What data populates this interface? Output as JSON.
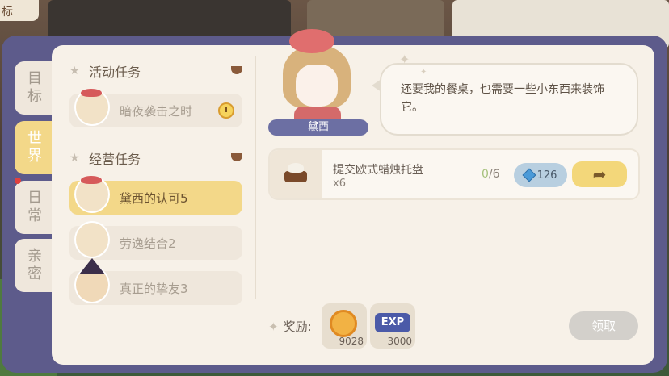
{
  "background": {
    "sign_text": "标"
  },
  "tabs": [
    {
      "label": "目标",
      "active": false,
      "has_dot": false
    },
    {
      "label": "世界",
      "active": true,
      "has_dot": false
    },
    {
      "label": "日常",
      "active": false,
      "has_dot": true
    },
    {
      "label": "亲密",
      "active": false,
      "has_dot": false
    }
  ],
  "sections": {
    "activity": {
      "title": "活动任务",
      "tasks": [
        {
          "label": "暗夜袭击之时",
          "icon": "clock-icon"
        }
      ]
    },
    "business": {
      "title": "经营任务",
      "tasks": [
        {
          "label": "黛西的认可5",
          "active": true
        },
        {
          "label": "劳逸结合2",
          "active": false
        },
        {
          "label": "真正的挚友3",
          "active": false
        }
      ]
    }
  },
  "npc": {
    "name": "黛西"
  },
  "dialog": {
    "text": "还要我的餐桌，也需要一些小东西来装饰它。"
  },
  "quest": {
    "title": "提交欧式蜡烛托盘",
    "quantity": "x6",
    "progress_current": "0",
    "progress_total": "/6",
    "gem_cost": "126",
    "go_icon": "arrow-right-icon"
  },
  "rewards": {
    "label": "奖励:",
    "coin": {
      "amount": "9028"
    },
    "exp": {
      "label": "EXP",
      "amount": "3000"
    }
  },
  "claim_label": "领取",
  "colors": {
    "frame": "#5d5b8b",
    "panel": "#f7f1e8",
    "active_tab": "#f3d889",
    "name_tag": "#6c6fa3",
    "gem_button": "#b8cfe0"
  }
}
